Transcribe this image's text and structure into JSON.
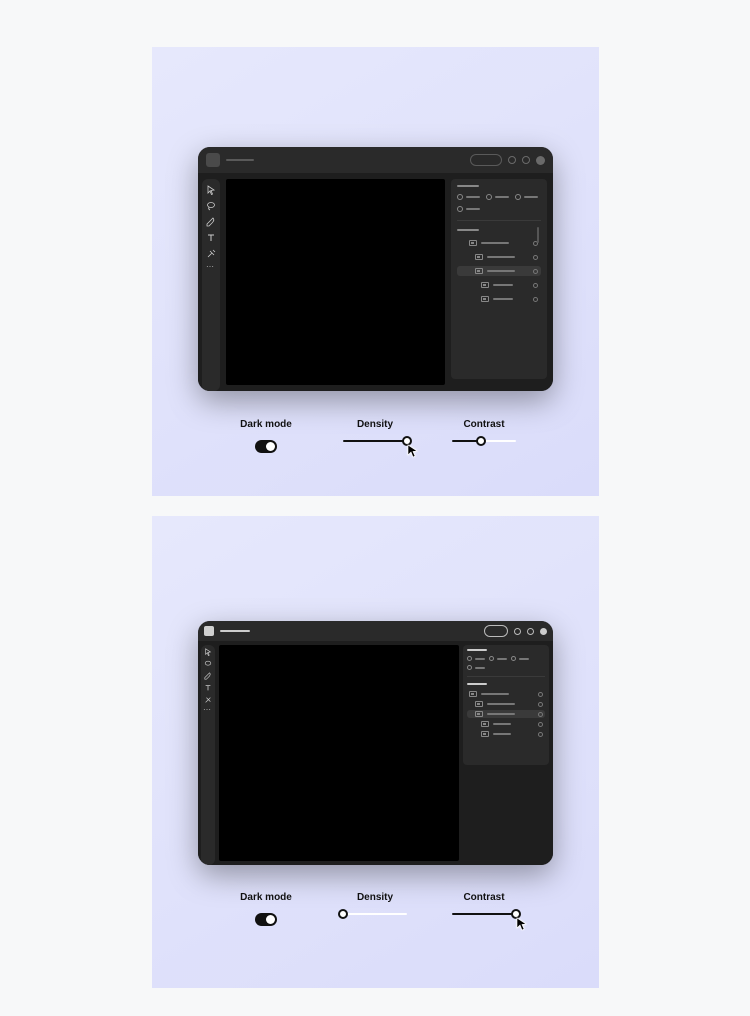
{
  "panels": [
    {
      "controls": {
        "dark_mode": {
          "label": "Dark mode",
          "on": true
        },
        "density": {
          "label": "Density",
          "value": 100
        },
        "contrast": {
          "label": "Contrast",
          "value": 45
        }
      },
      "cursor_on": "density"
    },
    {
      "controls": {
        "dark_mode": {
          "label": "Dark mode",
          "on": true
        },
        "density": {
          "label": "Density",
          "value": 0
        },
        "contrast": {
          "label": "Contrast",
          "value": 100
        }
      },
      "cursor_on": "contrast"
    }
  ]
}
